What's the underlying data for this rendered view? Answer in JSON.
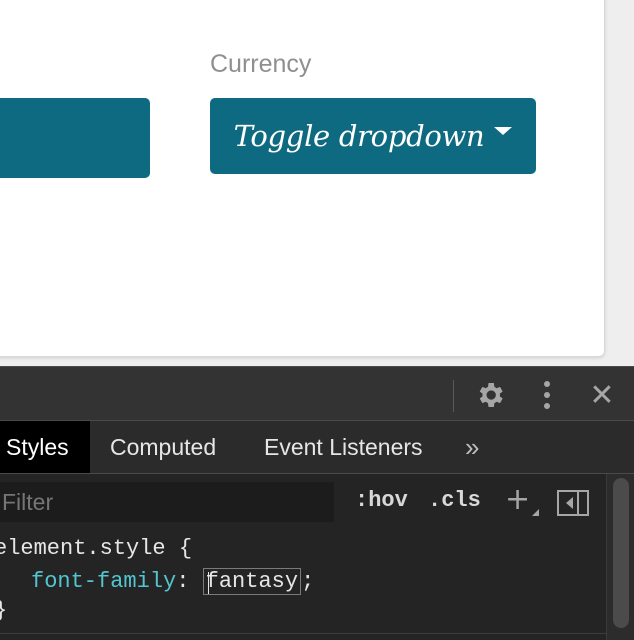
{
  "preview": {
    "currency_label": "Currency",
    "dropdown_button_label": "Toggle dropdown",
    "accent_color": "#0e6a80"
  },
  "devtools": {
    "toolbar": {
      "icons": [
        "gear-icon",
        "more-vertical-icon",
        "close-icon"
      ],
      "close_glyph": "✕"
    },
    "tabs": [
      {
        "label": "Styles",
        "active": true
      },
      {
        "label": "Computed",
        "active": false
      },
      {
        "label": "Event Listeners",
        "active": false
      },
      {
        "label": "»",
        "active": false
      }
    ],
    "filter": {
      "placeholder": "Filter",
      "hov_label": ":hov",
      "cls_label": ".cls",
      "new_rule_glyph": "+"
    },
    "rules": {
      "selector": "element.style {",
      "property": "font-family",
      "colon": ": ",
      "value": "fantasy",
      "semicolon": ";",
      "close_brace": "}"
    },
    "colors": {
      "panel_bg": "#242424",
      "property_color": "#52c6d0"
    }
  }
}
